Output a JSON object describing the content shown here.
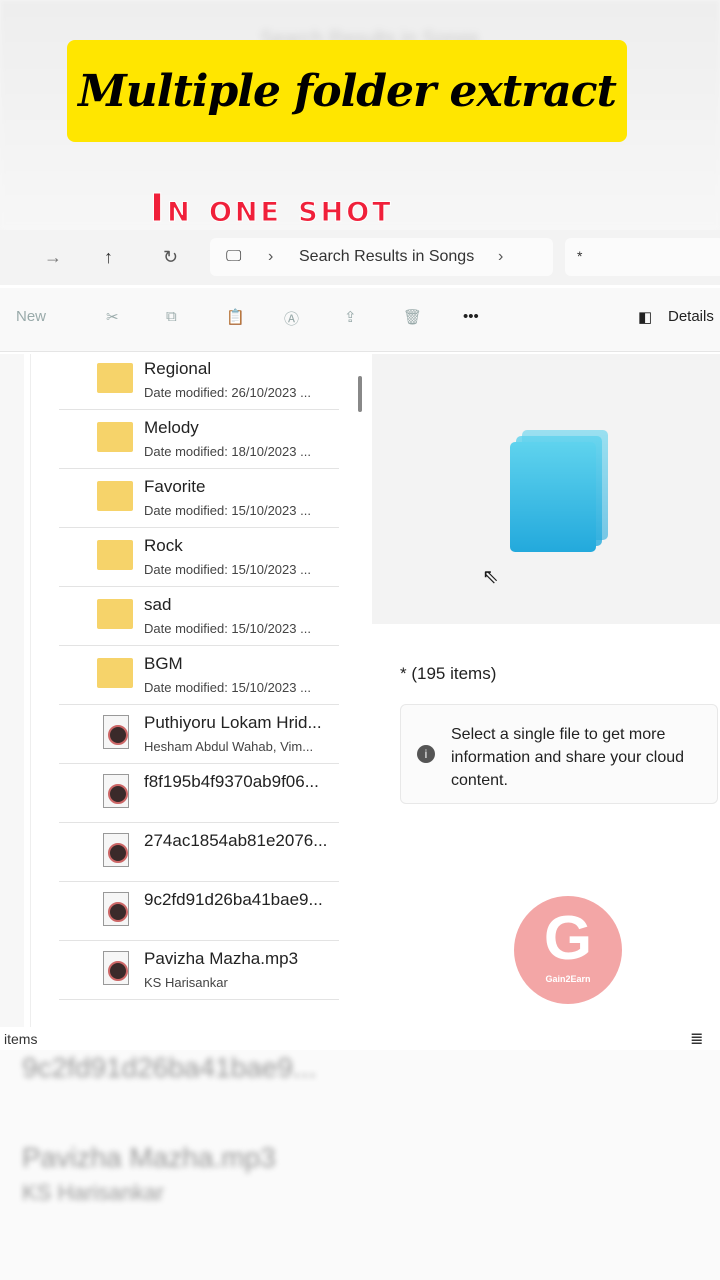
{
  "overlay": {
    "title": "Multiple folder extract",
    "subtitle": "In one shot"
  },
  "background_blur": {
    "breadcrumb": "Search Results in Songs",
    "item1": "9c2fd91d26ba41bae9...",
    "item2": "Pavizha Mazha.mp3",
    "item2_meta": "KS Harisankar"
  },
  "address": {
    "breadcrumb": "Search Results in Songs",
    "search_value": "*"
  },
  "toolbar": {
    "new_label": "New",
    "details_label": "Details",
    "more": "•••"
  },
  "files": [
    {
      "name": "Regional",
      "meta": "Date modified: 26/10/2023 ...",
      "type": "folder"
    },
    {
      "name": "Melody",
      "meta": "Date modified: 18/10/2023 ...",
      "type": "folder"
    },
    {
      "name": "Favorite",
      "meta": "Date modified: 15/10/2023 ...",
      "type": "folder"
    },
    {
      "name": "Rock",
      "meta": "Date modified: 15/10/2023 ...",
      "type": "folder"
    },
    {
      "name": "sad",
      "meta": "Date modified: 15/10/2023 ...",
      "type": "folder"
    },
    {
      "name": "BGM",
      "meta": "Date modified: 15/10/2023 ...",
      "type": "folder"
    },
    {
      "name": "Puthiyoru Lokam Hrid...",
      "meta": "Hesham Abdul Wahab, Vim...",
      "type": "audio"
    },
    {
      "name": "f8f195b4f9370ab9f06...",
      "meta": "",
      "type": "audio"
    },
    {
      "name": "274ac1854ab81e2076...",
      "meta": "",
      "type": "audio"
    },
    {
      "name": "9c2fd91d26ba41bae9...",
      "meta": "",
      "type": "audio"
    },
    {
      "name": "Pavizha Mazha.mp3",
      "meta": "KS Harisankar",
      "type": "audio"
    }
  ],
  "details": {
    "count": "* (195 items)",
    "info": "Select a single file to get more information and share your cloud content."
  },
  "watermark": {
    "label": "Gain2Earn",
    "color": "#f3a6a6"
  },
  "status": {
    "items": "items"
  },
  "colors": {
    "banner": "#ffe600",
    "subtitle": "#f0203a"
  }
}
